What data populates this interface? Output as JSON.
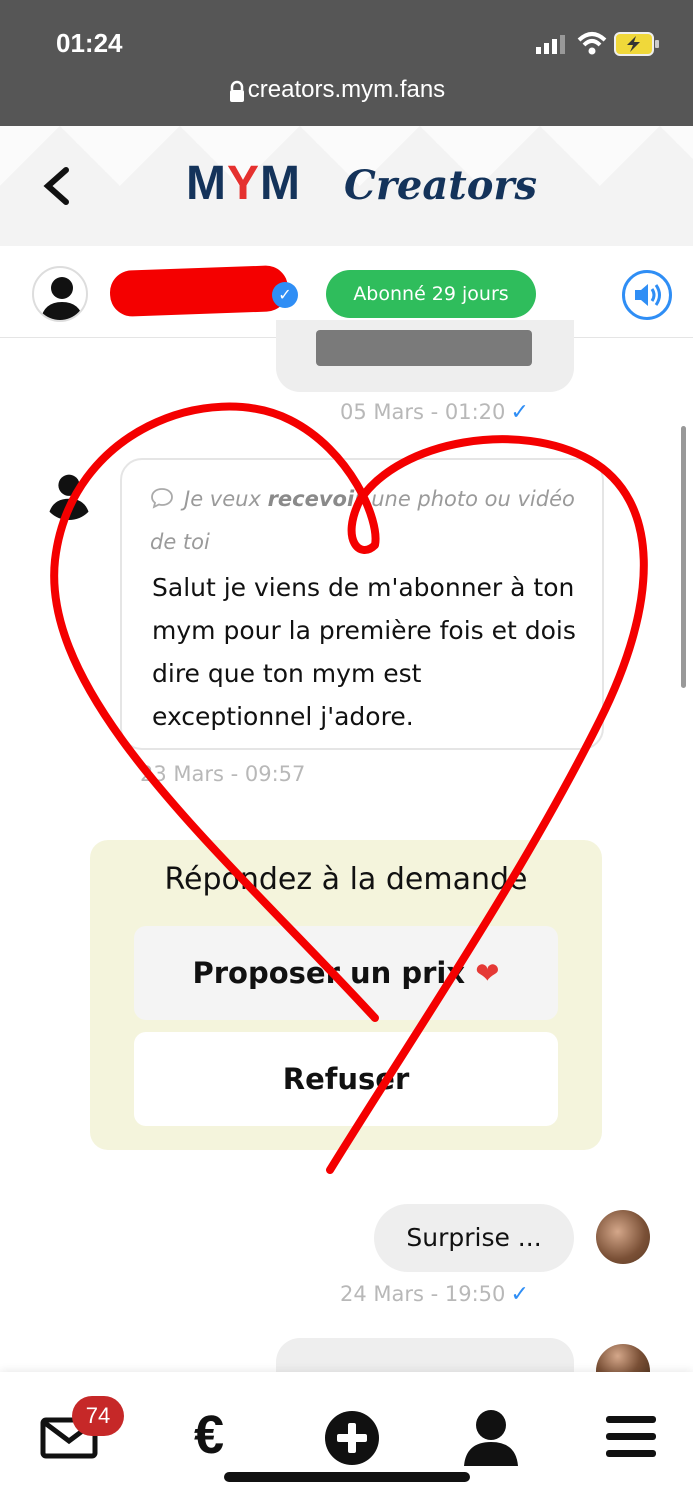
{
  "status_bar": {
    "time": "01:24",
    "url": "creators.mym.fans"
  },
  "header": {
    "logo_mym_m1": "M",
    "logo_mym_y": "Y",
    "logo_mym_m2": "M",
    "logo_creators": "Creators"
  },
  "chat": {
    "subscription_badge": "Abonné 29 jours",
    "prev_timestamp": "05 Mars - 01:20",
    "request_prefix": "Je veux ",
    "request_bold": "recevoir",
    "request_suffix": " une photo ou vidéo de toi",
    "message_text": "Salut je viens de m'abonner à ton mym pour la première fois et dois dire que ton mym est exceptionnel j'adore.",
    "message_timestamp": "23 Mars - 09:57",
    "reply_title": "Répondez à la demande",
    "propose_label": "Proposer un prix",
    "propose_heart": "❤",
    "refuse_label": "Refuser",
    "sent_text": "Surprise ...",
    "sent_timestamp": "24 Mars - 19:50",
    "tick": "✓"
  },
  "tab_bar": {
    "inbox_count": "74",
    "euro_symbol": "€"
  },
  "colors": {
    "accent_blue": "#2f8ef5",
    "badge_green": "#2fbd5c",
    "overlay_red": "#f40000",
    "reply_card": "#f4f4dc"
  }
}
